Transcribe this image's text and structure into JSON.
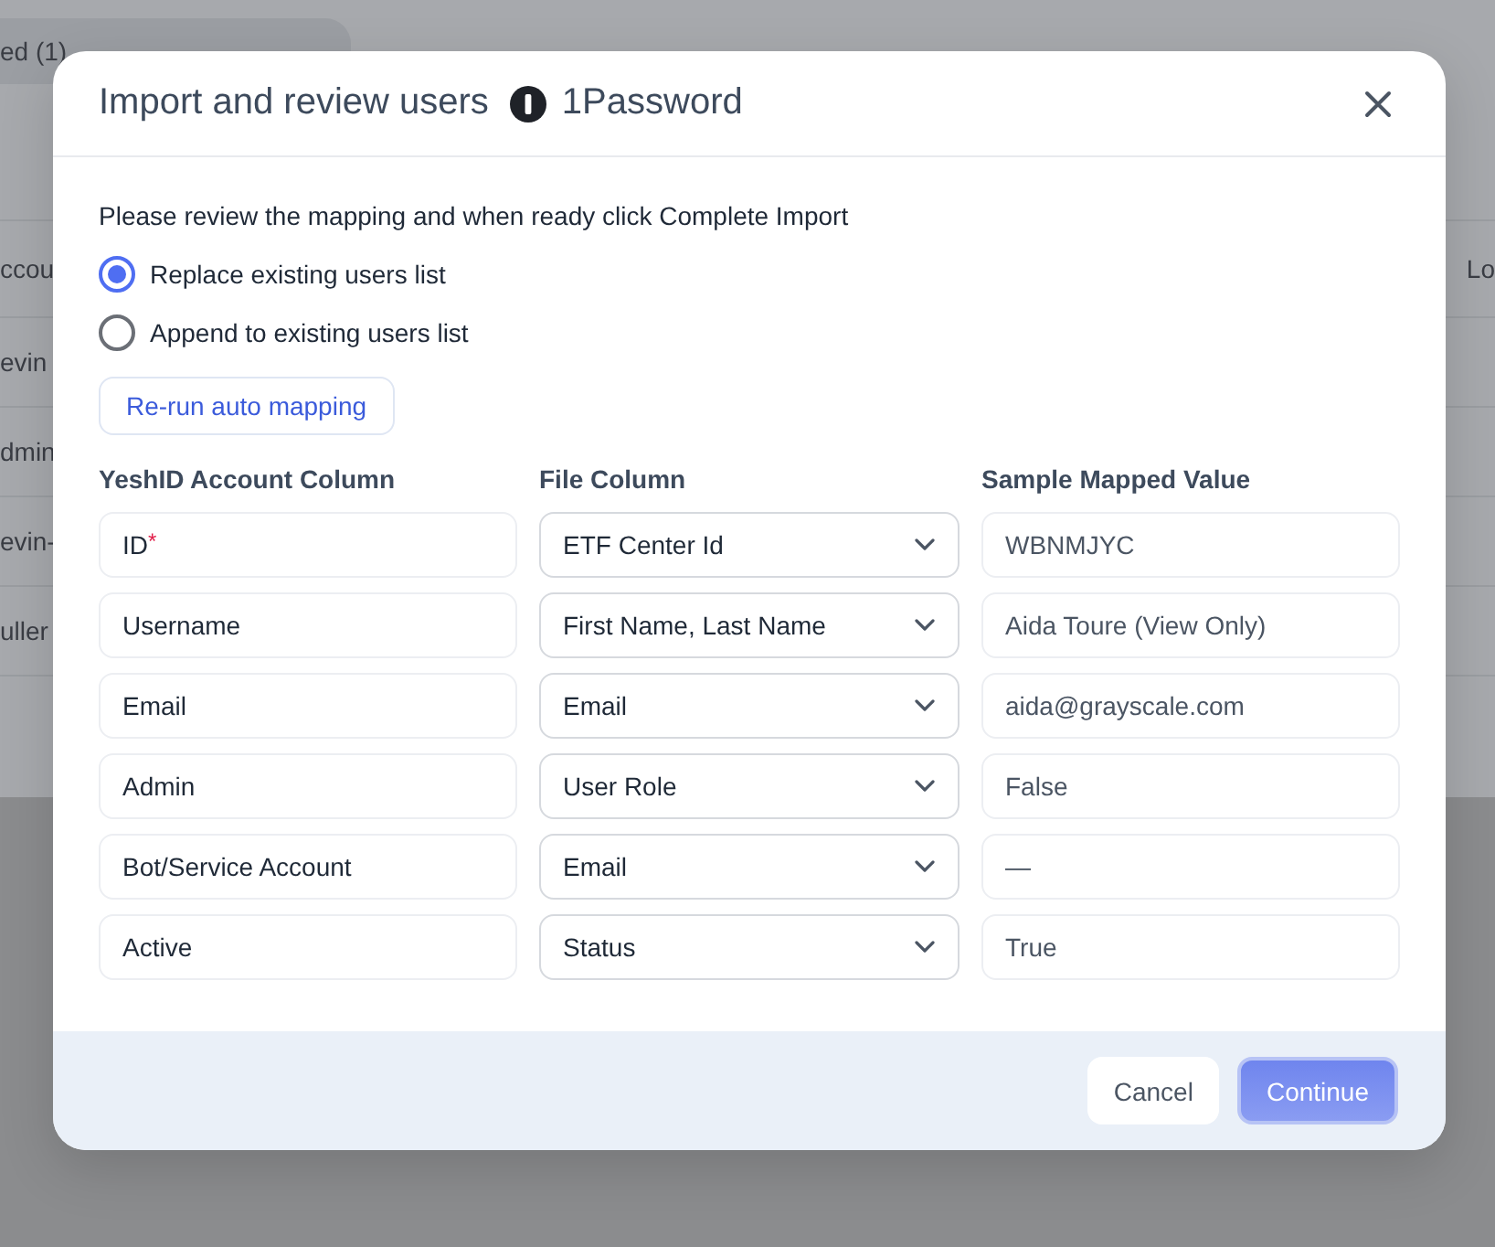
{
  "background": {
    "tab_label": "ed (1)",
    "header_left": "ccou",
    "header_right": "Lo",
    "rows": [
      "evin",
      "dmin",
      "evin-",
      "uller"
    ]
  },
  "dialog": {
    "title": "Import and review users",
    "app_name": "1Password",
    "instructions": "Please review the mapping and when ready click Complete Import",
    "options": [
      {
        "label": "Replace existing users list",
        "selected": true
      },
      {
        "label": "Append to existing users list",
        "selected": false
      }
    ],
    "rerun_button": "Re-run auto mapping",
    "columns": [
      "YeshID Account Column",
      "File Column",
      "Sample Mapped Value"
    ],
    "mappings": [
      {
        "field": "ID",
        "required_mark": "*",
        "file_column": "ETF Center Id",
        "sample": "WBNMJYC"
      },
      {
        "field": "Username",
        "file_column": "First Name, Last Name",
        "sample": "Aida Toure (View Only)"
      },
      {
        "field": "Email",
        "file_column": "Email",
        "sample": "aida@grayscale.com"
      },
      {
        "field": "Admin",
        "file_column": "User Role",
        "sample": "False"
      },
      {
        "field": "Bot/Service Account",
        "file_column": "Email",
        "sample": "—"
      },
      {
        "field": "Active",
        "file_column": "Status",
        "sample": "True"
      }
    ],
    "buttons": [
      {
        "label": "Cancel",
        "kind": "secondary"
      },
      {
        "label": "Continue",
        "kind": "primary"
      }
    ]
  }
}
